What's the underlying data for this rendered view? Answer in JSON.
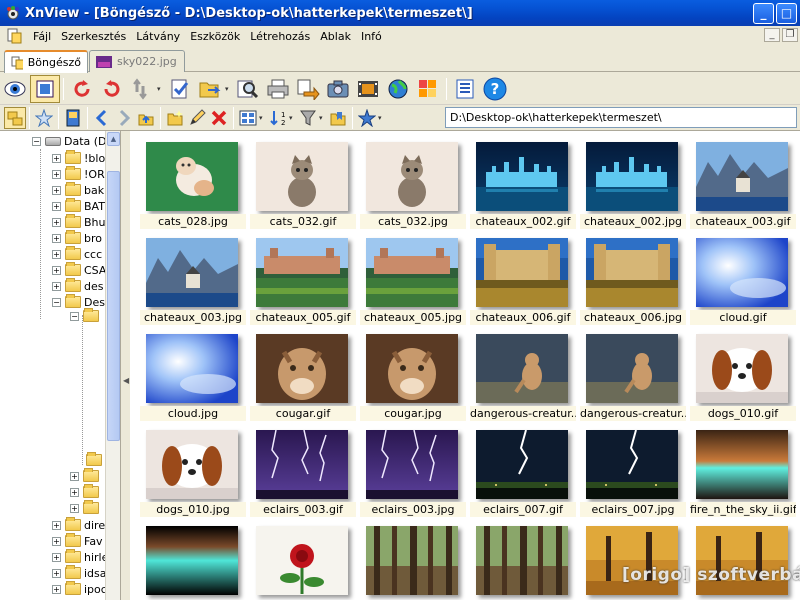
{
  "window": {
    "title": "XnView - [Böngésző - D:\\Desktop-ok\\hatterkepek\\termeszet\\]"
  },
  "menu": [
    "Fájl",
    "Szerkesztés",
    "Látvány",
    "Eszközök",
    "Létrehozás",
    "Ablak",
    "Infó"
  ],
  "tabs": [
    {
      "label": "Böngésző",
      "active": true
    },
    {
      "label": "sky022.jpg",
      "active": false
    }
  ],
  "toolbar": {
    "icons": [
      "eye-icon",
      "fullscreen-icon",
      "rotate-left-icon",
      "rotate-right-icon",
      "convert-icon",
      "select-icon",
      "open-folder-icon",
      "search-icon",
      "print-icon",
      "copy-to-icon",
      "camera-icon",
      "filmstrip-icon",
      "globe-icon",
      "mosaic-icon",
      "properties-icon",
      "help-icon"
    ]
  },
  "path": {
    "value": "D:\\Desktop-ok\\hatterkepek\\termeszet\\"
  },
  "tree": {
    "drive_label": "Data (D",
    "items": [
      "!blo",
      "!OR",
      "bak",
      "BAT",
      "Bhu",
      "bro",
      "ccc",
      "CSA",
      "des",
      "Des"
    ],
    "bottom_items": [
      "dire",
      "Fav",
      "hirle",
      "idsa",
      "ipoc"
    ]
  },
  "thumbnails": [
    {
      "name": "cats_028.jpg",
      "art": "cat1"
    },
    {
      "name": "cats_032.gif",
      "art": "cat2"
    },
    {
      "name": "cats_032.jpg",
      "art": "cat2"
    },
    {
      "name": "chateaux_002.gif",
      "art": "castle_blue"
    },
    {
      "name": "chateaux_002.jpg",
      "art": "castle_blue"
    },
    {
      "name": "chateaux_003.gif",
      "art": "castle_mtn"
    },
    {
      "name": "chateaux_003.jpg",
      "art": "castle_mtn"
    },
    {
      "name": "chateaux_005.gif",
      "art": "castle_garden"
    },
    {
      "name": "chateaux_005.jpg",
      "art": "castle_garden"
    },
    {
      "name": "chateaux_006.gif",
      "art": "castle_moat"
    },
    {
      "name": "chateaux_006.jpg",
      "art": "castle_moat"
    },
    {
      "name": "cloud.gif",
      "art": "cloud"
    },
    {
      "name": "cloud.jpg",
      "art": "cloud"
    },
    {
      "name": "cougar.gif",
      "art": "cougar"
    },
    {
      "name": "cougar.jpg",
      "art": "cougar"
    },
    {
      "name": "dangerous-creatur...",
      "art": "puma"
    },
    {
      "name": "dangerous-creatur...",
      "art": "puma"
    },
    {
      "name": "dogs_010.gif",
      "art": "dog"
    },
    {
      "name": "dogs_010.jpg",
      "art": "dog"
    },
    {
      "name": "eclairs_003.gif",
      "art": "lightning"
    },
    {
      "name": "eclairs_003.jpg",
      "art": "lightning"
    },
    {
      "name": "eclairs_007.gif",
      "art": "lightning2"
    },
    {
      "name": "eclairs_007.jpg",
      "art": "lightning2"
    },
    {
      "name": "fire_n_the_sky_ii.gif",
      "art": "fire_sky"
    },
    {
      "name": "",
      "art": "fire_sky2"
    },
    {
      "name": "",
      "art": "rose"
    },
    {
      "name": "",
      "art": "forest"
    },
    {
      "name": "",
      "art": "forest"
    },
    {
      "name": "",
      "art": "autumn"
    },
    {
      "name": "",
      "art": "autumn"
    }
  ],
  "watermark": "[origo] szoftverbázis",
  "colors": {
    "titlebar": "#0a5ddf",
    "tab_accent": "#e68b2c",
    "label_bg": "#fbf7e3"
  }
}
